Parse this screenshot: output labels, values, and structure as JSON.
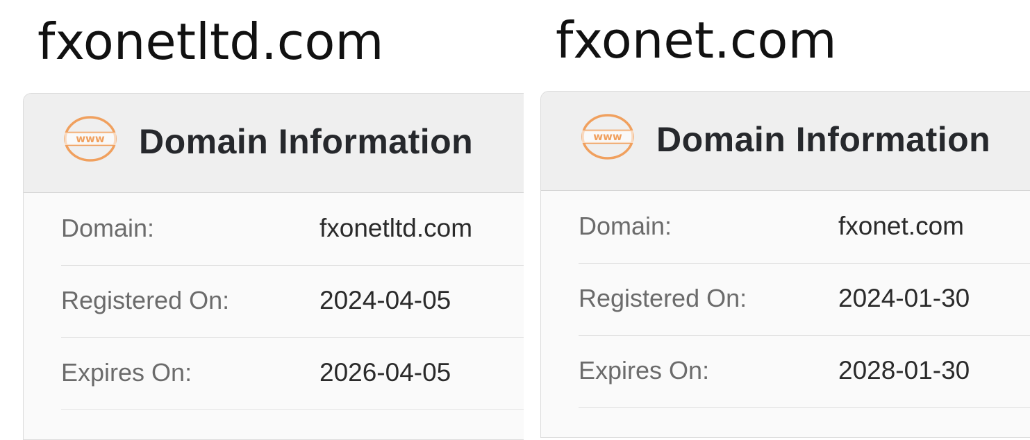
{
  "colors": {
    "accent": "#f0a05e",
    "header_bg": "#efefef",
    "card_bg": "#fafafa",
    "label": "#6b6b6b",
    "value": "#2a2a2a"
  },
  "panels": [
    {
      "domain_heading": "fxonetltd.com",
      "card": {
        "icon": "www-icon",
        "icon_text": "www",
        "title": "Domain Information",
        "rows": [
          {
            "label": "Domain:",
            "value": "fxonetltd.com"
          },
          {
            "label": "Registered On:",
            "value": "2024-04-05"
          },
          {
            "label": "Expires On:",
            "value": "2026-04-05"
          }
        ]
      }
    },
    {
      "domain_heading": "fxonet.com",
      "card": {
        "icon": "www-icon",
        "icon_text": "www",
        "title": "Domain Information",
        "rows": [
          {
            "label": "Domain:",
            "value": "fxonet.com"
          },
          {
            "label": "Registered On:",
            "value": "2024-01-30"
          },
          {
            "label": "Expires On:",
            "value": "2028-01-30"
          }
        ]
      }
    }
  ]
}
